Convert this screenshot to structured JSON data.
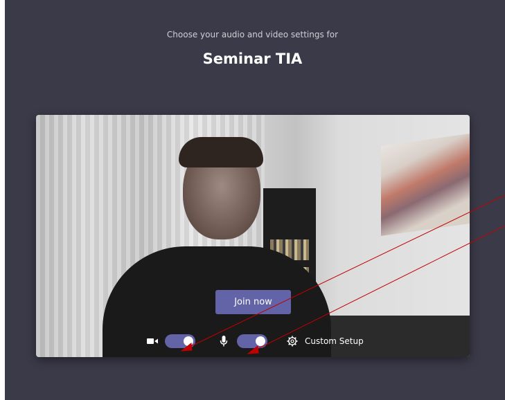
{
  "header": {
    "subtitle": "Choose your audio and video settings for",
    "meeting_title": "Seminar TIA"
  },
  "preview": {
    "join_label": "Join now"
  },
  "controls": {
    "camera": {
      "icon": "camera-icon",
      "enabled": true
    },
    "mic": {
      "icon": "mic-icon",
      "enabled": true
    },
    "custom_setup_icon": "gear-icon",
    "custom_setup_label": "Custom Setup"
  },
  "colors": {
    "background": "#3b3a48",
    "accent": "#6264a7",
    "annotation_arrow": "#c00000"
  }
}
